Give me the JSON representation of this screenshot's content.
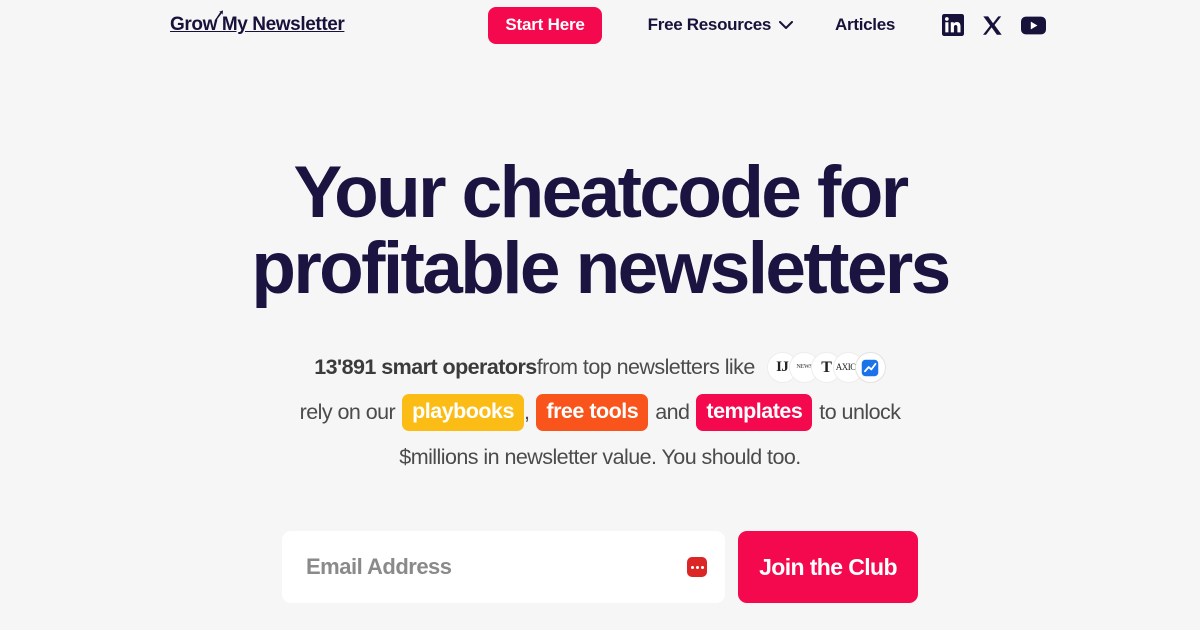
{
  "theme": {
    "background": "#f6f6f6",
    "headline_color": "#1b1340",
    "accent_pink": "#f5094e",
    "accent_yellow": "#fbbc16",
    "accent_orange": "#f9541c",
    "body_text": "#4b4b4b"
  },
  "nav": {
    "logo_text": "Grow My Newsletter",
    "logo_icon": "growth-arrow-icon",
    "start_here_label": "Start Here",
    "resources_label": "Free Resources",
    "resources_chevron": "chevron-down-icon",
    "articles_label": "Articles",
    "socials": [
      {
        "name": "linkedin-icon",
        "label": "LinkedIn"
      },
      {
        "name": "x-icon",
        "label": "X"
      },
      {
        "name": "youtube-icon",
        "label": "YouTube"
      }
    ]
  },
  "hero": {
    "headline_line1": "Your cheatcode for",
    "headline_line2": "profitable newsletters",
    "sub": {
      "count": "13'891 smart operators",
      "after_count": " from top newsletters like",
      "line2_prefix": "rely on our",
      "pill1": "playbooks",
      "comma": ",",
      "pill2": "free tools",
      "and": "and",
      "pill3": "templates",
      "line2_suffix": "to unlock",
      "line3": "$millions in newsletter value. You should too."
    },
    "avatars": [
      {
        "name": "avatar-publication-1",
        "glyph": "IJ"
      },
      {
        "name": "avatar-publication-2",
        "glyph": "NEWS"
      },
      {
        "name": "avatar-publication-3",
        "glyph": "T"
      },
      {
        "name": "avatar-publication-4",
        "glyph": "AXIOS"
      },
      {
        "name": "avatar-publication-5",
        "glyph": "chart-icon"
      }
    ]
  },
  "form": {
    "email_placeholder": "Email Address",
    "email_value": "",
    "autofill_icon": "password-manager-icon",
    "submit_label": "Join the Club"
  }
}
